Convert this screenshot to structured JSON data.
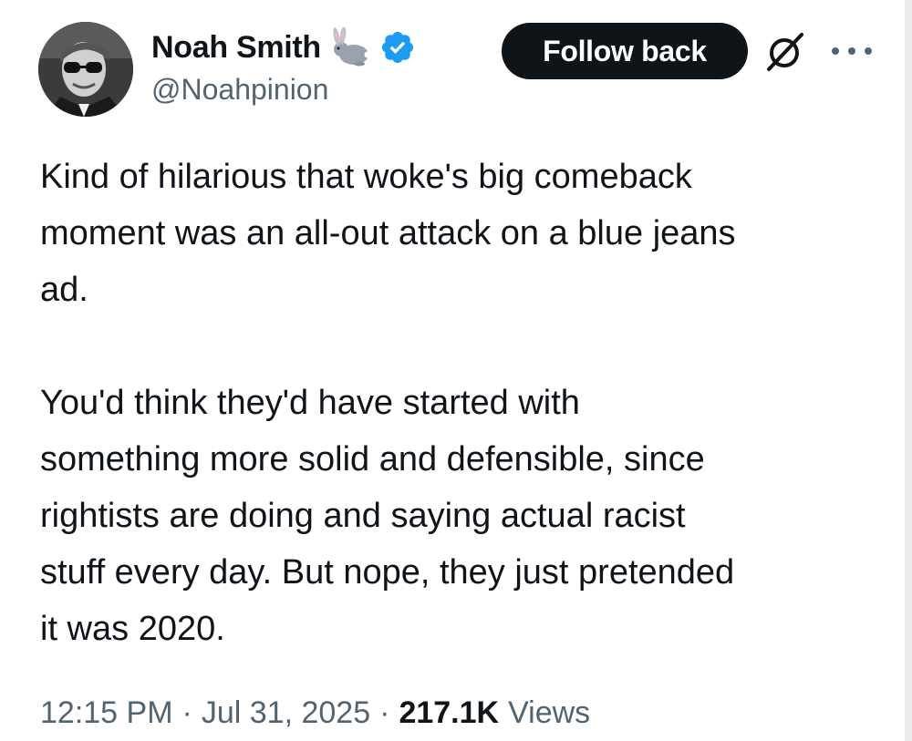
{
  "author": {
    "display_name": "Noah Smith",
    "handle": "@Noahpinion",
    "name_emoji": "rabbit-icon",
    "verified": true,
    "verified_color": "#1d9bf0"
  },
  "actions": {
    "follow_label": "Follow back",
    "grok_icon": "slashed-circle-icon",
    "more_icon": "more-options-icon"
  },
  "tweet": {
    "paragraphs": [
      "Kind of hilarious that woke's big comeback\nmoment was an all-out attack on a blue jeans\nad.",
      "You'd think they'd have started with\nsomething more solid and defensible, since\nrightists are doing and saying actual racist\nstuff every day. But nope, they just pretended\nit was 2020."
    ]
  },
  "meta": {
    "time": "12:15 PM",
    "separator": "·",
    "date": "Jul 31, 2025",
    "views_count": "217.1K",
    "views_label": "Views"
  },
  "colors": {
    "text_primary": "#0f1419",
    "text_secondary": "#536471",
    "button_bg": "#0f1419",
    "button_text": "#ffffff"
  }
}
